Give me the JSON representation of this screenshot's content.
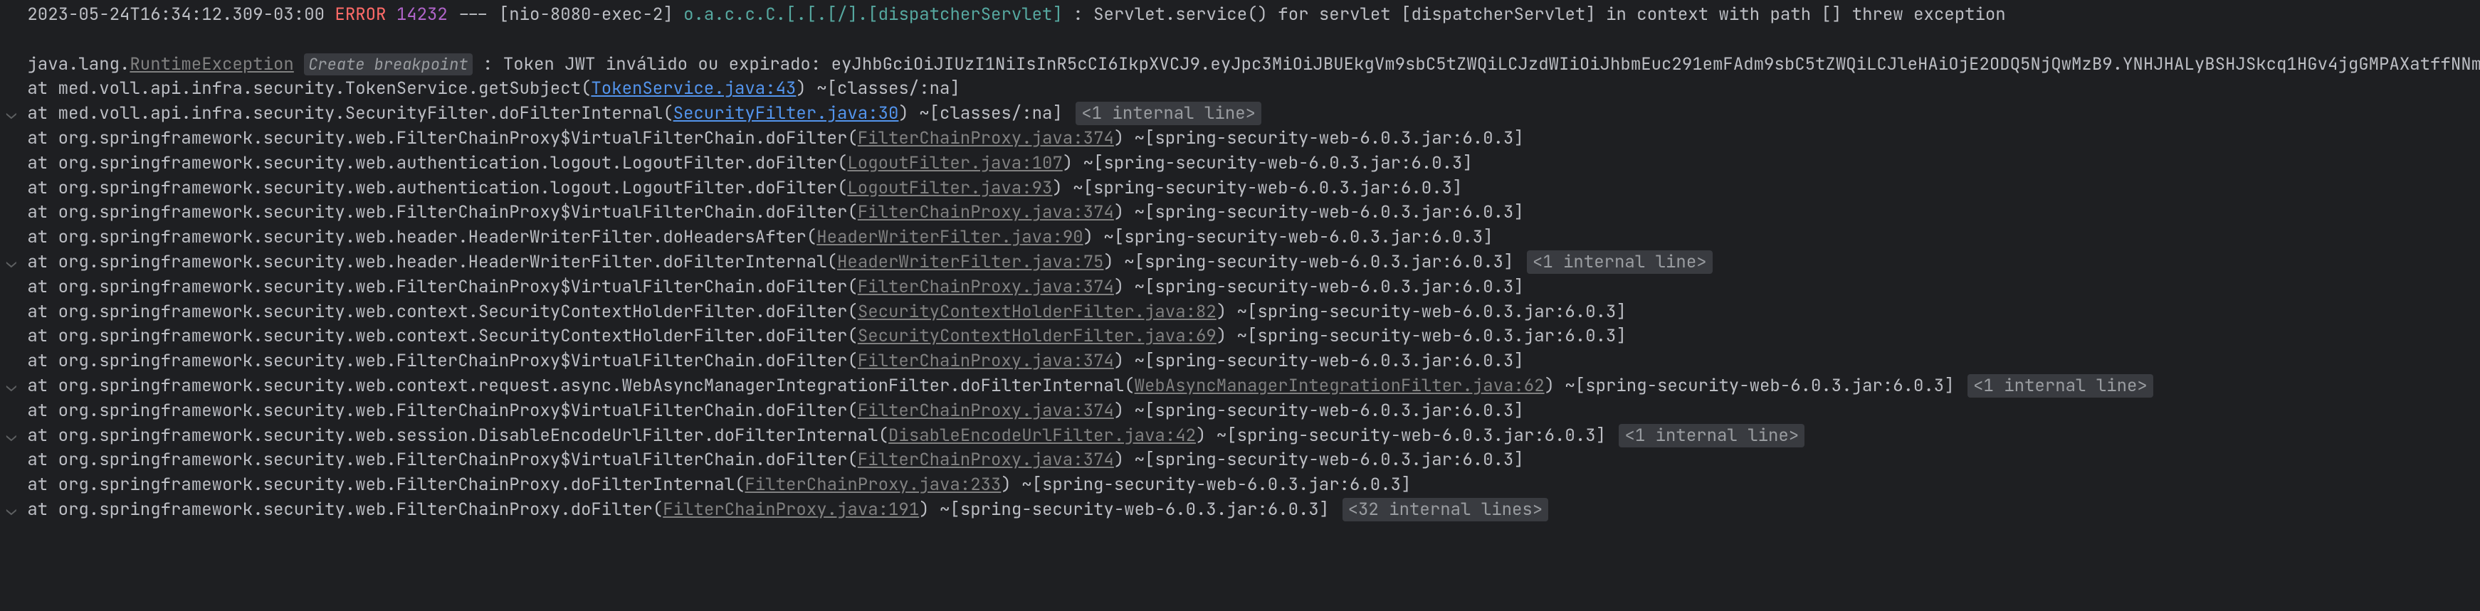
{
  "header": {
    "timestamp": "2023-05-24T16:34:12.309-03:00",
    "level": "ERROR",
    "pid": "14232",
    "dashes": "---",
    "thread": "[nio-8080-exec-2]",
    "logger": "o.a.c.c.C.[.[.[/].[dispatcherServlet]",
    "sep": ":",
    "message": "Servlet.service() for servlet [dispatcherServlet] in context with path [] threw exception"
  },
  "exception": {
    "prefix": "java.lang.",
    "name": "RuntimeException",
    "breakpoint": "Create breakpoint",
    "message": ": Token JWT inválido ou expirado:  eyJhbGciOiJIUzI1NiIsInR5cCI6IkpXVCJ9.eyJpc3MiOiJBUEkgVm9sbC5tZWQiLCJzdWIiOiJhbmEuc291emFAdm9sbC5tZWQiLCJleHAiOjE2ODQ5NjQwMzB9.YNHJHALyBSHJSkcq1HGv4jgGMPAXatffNNmYCJMhIVs"
  },
  "frames": [
    {
      "gutter": "",
      "text": "at med.voll.api.infra.security.TokenService.getSubject(",
      "link": "TokenService.java:43",
      "linkClass": "link",
      "suffix": ") ~[classes/:na]",
      "hint": ""
    },
    {
      "gutter": "⌄",
      "text": "at med.voll.api.infra.security.SecurityFilter.doFilterInternal(",
      "link": "SecurityFilter.java:30",
      "linkClass": "link",
      "suffix": ") ~[classes/:na]",
      "hint": "<1 internal line>"
    },
    {
      "gutter": "",
      "text": "at org.springframework.security.web.FilterChainProxy$VirtualFilterChain.doFilter(",
      "link": "FilterChainProxy.java:374",
      "linkClass": "linkg",
      "suffix": ") ~[spring-security-web-6.0.3.jar:6.0.3]",
      "hint": ""
    },
    {
      "gutter": "",
      "text": "at org.springframework.security.web.authentication.logout.LogoutFilter.doFilter(",
      "link": "LogoutFilter.java:107",
      "linkClass": "linkg",
      "suffix": ") ~[spring-security-web-6.0.3.jar:6.0.3]",
      "hint": ""
    },
    {
      "gutter": "",
      "text": "at org.springframework.security.web.authentication.logout.LogoutFilter.doFilter(",
      "link": "LogoutFilter.java:93",
      "linkClass": "linkg",
      "suffix": ") ~[spring-security-web-6.0.3.jar:6.0.3]",
      "hint": ""
    },
    {
      "gutter": "",
      "text": "at org.springframework.security.web.FilterChainProxy$VirtualFilterChain.doFilter(",
      "link": "FilterChainProxy.java:374",
      "linkClass": "linkg",
      "suffix": ") ~[spring-security-web-6.0.3.jar:6.0.3]",
      "hint": ""
    },
    {
      "gutter": "",
      "text": "at org.springframework.security.web.header.HeaderWriterFilter.doHeadersAfter(",
      "link": "HeaderWriterFilter.java:90",
      "linkClass": "linkg",
      "suffix": ") ~[spring-security-web-6.0.3.jar:6.0.3]",
      "hint": ""
    },
    {
      "gutter": "⌄",
      "text": "at org.springframework.security.web.header.HeaderWriterFilter.doFilterInternal(",
      "link": "HeaderWriterFilter.java:75",
      "linkClass": "linkg",
      "suffix": ") ~[spring-security-web-6.0.3.jar:6.0.3]",
      "hint": "<1 internal line>"
    },
    {
      "gutter": "",
      "text": "at org.springframework.security.web.FilterChainProxy$VirtualFilterChain.doFilter(",
      "link": "FilterChainProxy.java:374",
      "linkClass": "linkg",
      "suffix": ") ~[spring-security-web-6.0.3.jar:6.0.3]",
      "hint": ""
    },
    {
      "gutter": "",
      "text": "at org.springframework.security.web.context.SecurityContextHolderFilter.doFilter(",
      "link": "SecurityContextHolderFilter.java:82",
      "linkClass": "linkg",
      "suffix": ") ~[spring-security-web-6.0.3.jar:6.0.3]",
      "hint": ""
    },
    {
      "gutter": "",
      "text": "at org.springframework.security.web.context.SecurityContextHolderFilter.doFilter(",
      "link": "SecurityContextHolderFilter.java:69",
      "linkClass": "linkg",
      "suffix": ") ~[spring-security-web-6.0.3.jar:6.0.3]",
      "hint": ""
    },
    {
      "gutter": "",
      "text": "at org.springframework.security.web.FilterChainProxy$VirtualFilterChain.doFilter(",
      "link": "FilterChainProxy.java:374",
      "linkClass": "linkg",
      "suffix": ") ~[spring-security-web-6.0.3.jar:6.0.3]",
      "hint": ""
    },
    {
      "gutter": "⌄",
      "text": "at org.springframework.security.web.context.request.async.WebAsyncManagerIntegrationFilter.doFilterInternal(",
      "link": "WebAsyncManagerIntegrationFilter.java:62",
      "linkClass": "linkg",
      "suffix": ") ~[spring-security-web-6.0.3.jar:6.0.3]",
      "hint": "<1 internal line>"
    },
    {
      "gutter": "",
      "text": "at org.springframework.security.web.FilterChainProxy$VirtualFilterChain.doFilter(",
      "link": "FilterChainProxy.java:374",
      "linkClass": "linkg",
      "suffix": ") ~[spring-security-web-6.0.3.jar:6.0.3]",
      "hint": ""
    },
    {
      "gutter": "⌄",
      "text": "at org.springframework.security.web.session.DisableEncodeUrlFilter.doFilterInternal(",
      "link": "DisableEncodeUrlFilter.java:42",
      "linkClass": "linkg",
      "suffix": ") ~[spring-security-web-6.0.3.jar:6.0.3]",
      "hint": "<1 internal line>"
    },
    {
      "gutter": "",
      "text": "at org.springframework.security.web.FilterChainProxy$VirtualFilterChain.doFilter(",
      "link": "FilterChainProxy.java:374",
      "linkClass": "linkg",
      "suffix": ") ~[spring-security-web-6.0.3.jar:6.0.3]",
      "hint": ""
    },
    {
      "gutter": "",
      "text": "at org.springframework.security.web.FilterChainProxy.doFilterInternal(",
      "link": "FilterChainProxy.java:233",
      "linkClass": "linkg",
      "suffix": ") ~[spring-security-web-6.0.3.jar:6.0.3]",
      "hint": ""
    },
    {
      "gutter": "⌄",
      "text": "at org.springframework.security.web.FilterChainProxy.doFilter(",
      "link": "FilterChainProxy.java:191",
      "linkClass": "linkg",
      "suffix": ") ~[spring-security-web-6.0.3.jar:6.0.3]",
      "hint": "<32 internal lines>"
    }
  ]
}
